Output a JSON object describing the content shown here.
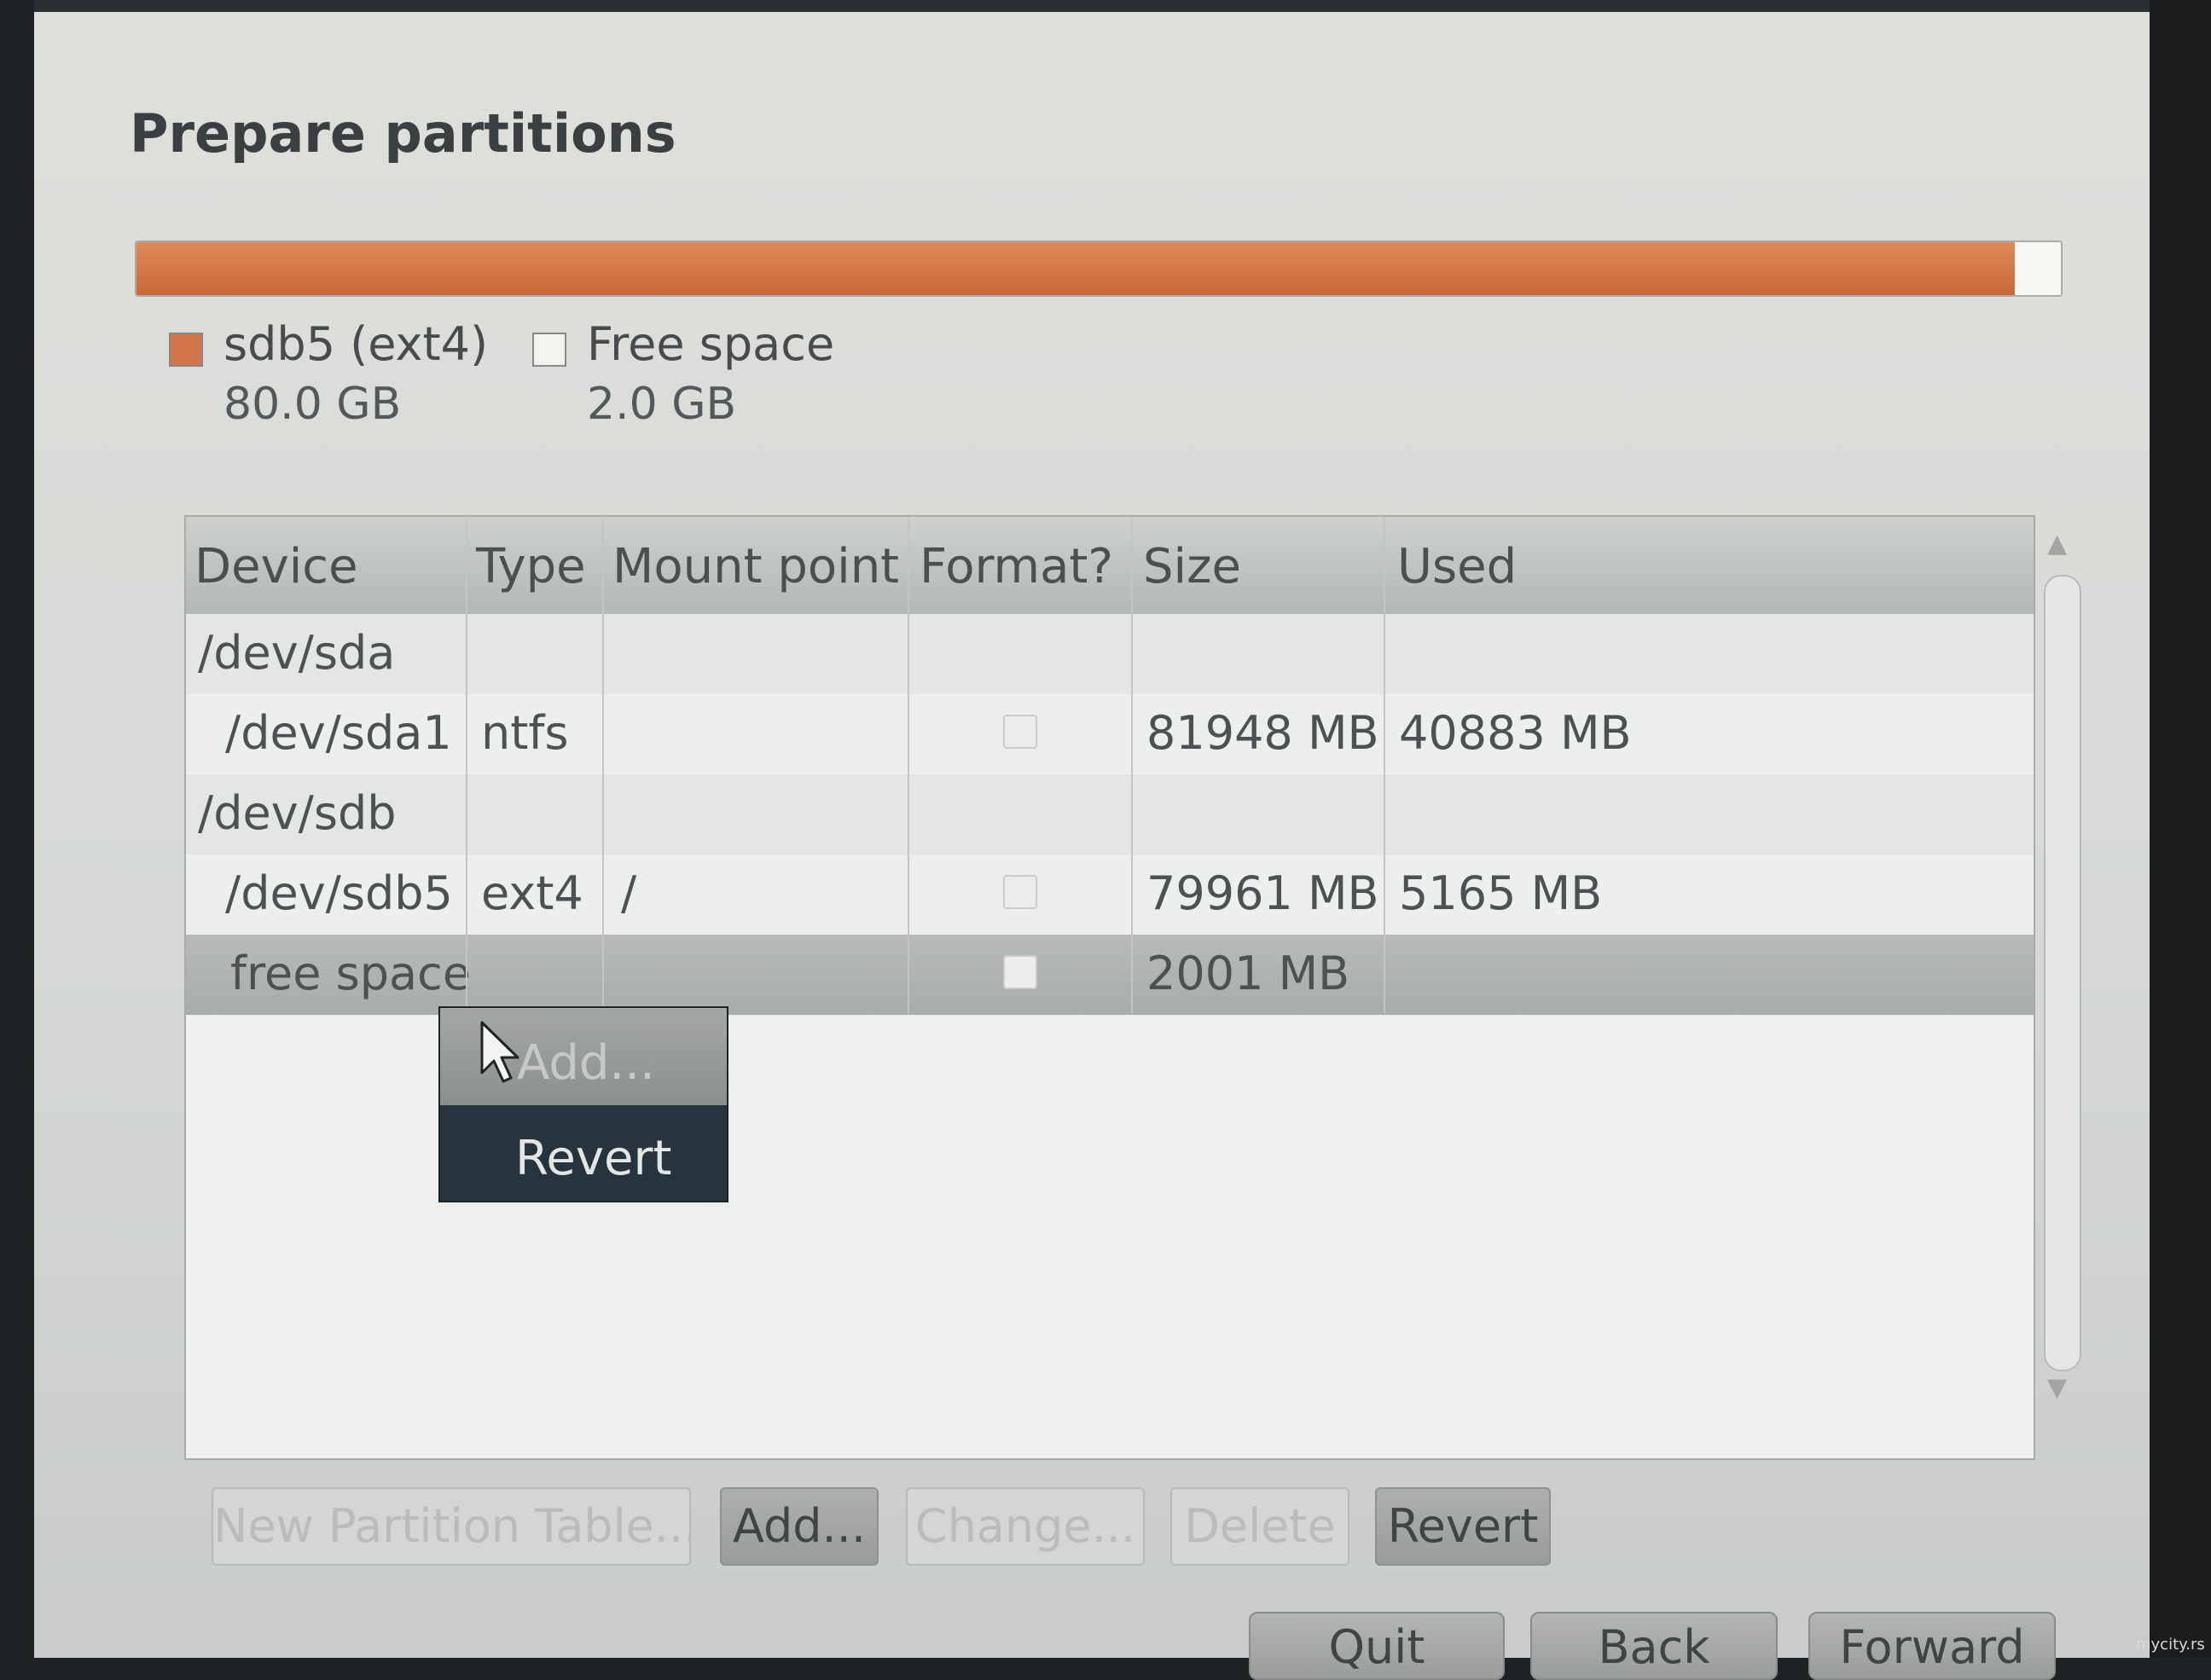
{
  "page": {
    "title": "Prepare partitions"
  },
  "partition_bar": {
    "segments": [
      {
        "name": "sdb5-segment",
        "fraction": 0.976,
        "color": "#d4764a"
      },
      {
        "name": "free-space-segment",
        "fraction": 0.024,
        "color": "#f7f7f4"
      }
    ]
  },
  "legend": [
    {
      "label": "sdb5 (ext4)",
      "size": "80.0 GB",
      "color": "#d4764a"
    },
    {
      "label": "Free space",
      "size": "2.0 GB",
      "color": "#f3f3f0"
    }
  ],
  "table": {
    "columns": [
      "Device",
      "Type",
      "Mount point",
      "Format?",
      "Size",
      "Used"
    ],
    "rows": [
      {
        "device": "/dev/sda",
        "type": "",
        "mount": "",
        "size": "",
        "used": "",
        "format_checkbox": false
      },
      {
        "device": "/dev/sda1",
        "type": "ntfs",
        "mount": "",
        "size": "81948 MB",
        "used": "40883 MB",
        "format_checkbox": true,
        "format_checked": false
      },
      {
        "device": "/dev/sdb",
        "type": "",
        "mount": "",
        "size": "",
        "used": "",
        "format_checkbox": false
      },
      {
        "device": "/dev/sdb5",
        "type": "ext4",
        "mount": "/",
        "size": "79961 MB",
        "used": "5165 MB",
        "format_checkbox": true,
        "format_checked": false
      },
      {
        "device": "free space",
        "type": "",
        "mount": "",
        "size": "2001 MB",
        "used": "",
        "format_checkbox": true,
        "format_checked": false,
        "selected": true
      }
    ]
  },
  "context_menu": {
    "add_label": "Add...",
    "revert_label": "Revert"
  },
  "buttons": {
    "new_partition_table": "New Partition Table...",
    "add": "Add...",
    "change": "Change...",
    "delete": "Delete",
    "revert": "Revert"
  },
  "nav": {
    "quit": "Quit",
    "back": "Back",
    "forward": "Forward"
  },
  "watermark": "mycity.rs",
  "icons": {
    "cursor": "arrow-cursor-icon",
    "scroll_up": "scroll-up-arrow-icon",
    "scroll_down": "scroll-down-arrow-icon"
  }
}
